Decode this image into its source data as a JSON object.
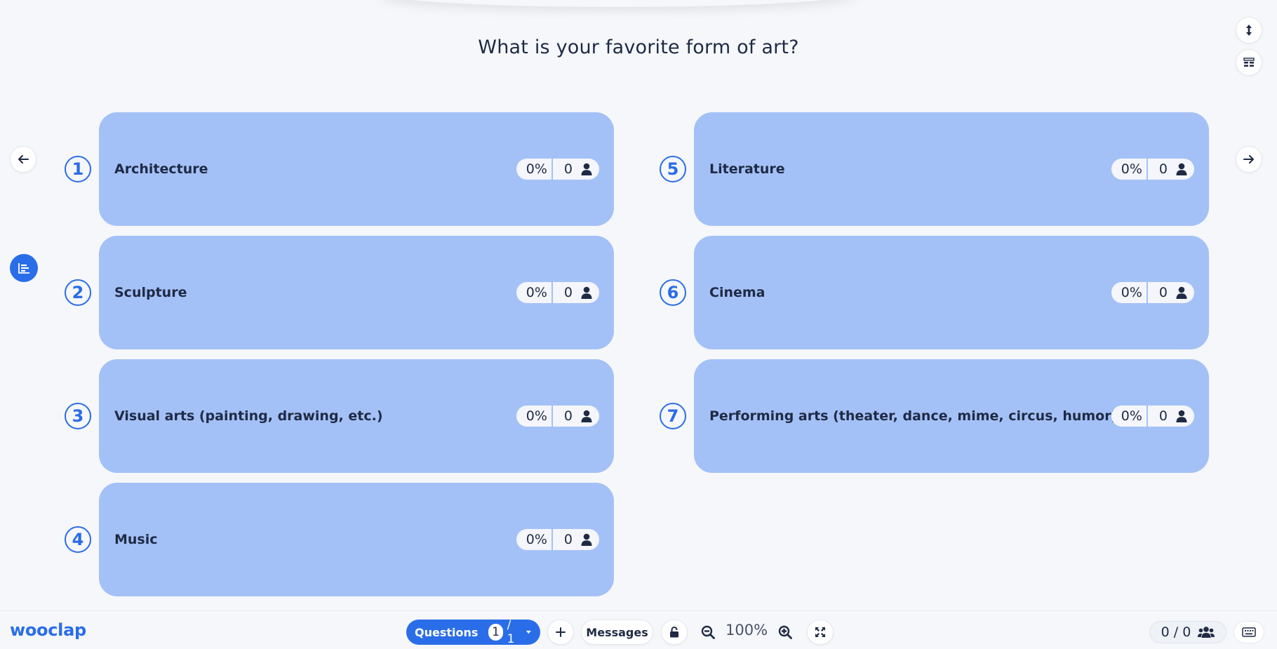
{
  "question": {
    "title": "What is your favorite form of art?"
  },
  "choices": [
    {
      "number": "1",
      "label": "Architecture",
      "percent": "0%",
      "count": "0"
    },
    {
      "number": "2",
      "label": "Sculpture",
      "percent": "0%",
      "count": "0"
    },
    {
      "number": "3",
      "label": "Visual arts (painting, drawing, etc.)",
      "percent": "0%",
      "count": "0"
    },
    {
      "number": "4",
      "label": "Music",
      "percent": "0%",
      "count": "0"
    },
    {
      "number": "5",
      "label": "Literature",
      "percent": "0%",
      "count": "0"
    },
    {
      "number": "6",
      "label": "Cinema",
      "percent": "0%",
      "count": "0"
    },
    {
      "number": "7",
      "label": "Performing arts (theater, dance, mime, circus, humor)",
      "percent": "0%",
      "count": "0"
    }
  ],
  "toolbar": {
    "logo": "wooclap",
    "questions_label": "Questions",
    "current_question": "1",
    "total_questions": "/ 1",
    "messages_label": "Messages",
    "zoom": "100%",
    "participants": "0 / 0"
  },
  "icons": {
    "prev": "arrow-left-icon",
    "next": "arrow-right-icon",
    "results": "bar-chart-icon",
    "user": "user-icon",
    "users": "users-icon",
    "expand_vertical": "expand-vertical-icon",
    "layout": "layout-icon",
    "add": "plus-icon",
    "lock": "lock-icon",
    "zoom_out": "zoom-out-icon",
    "zoom_in": "zoom-in-icon",
    "fullscreen": "fullscreen-icon",
    "keyboard": "keyboard-icon"
  },
  "colors": {
    "accent": "#2a6de8",
    "choice_bg": "#a4c1f7",
    "background": "#f5f7fa",
    "text": "#1f2a44"
  }
}
